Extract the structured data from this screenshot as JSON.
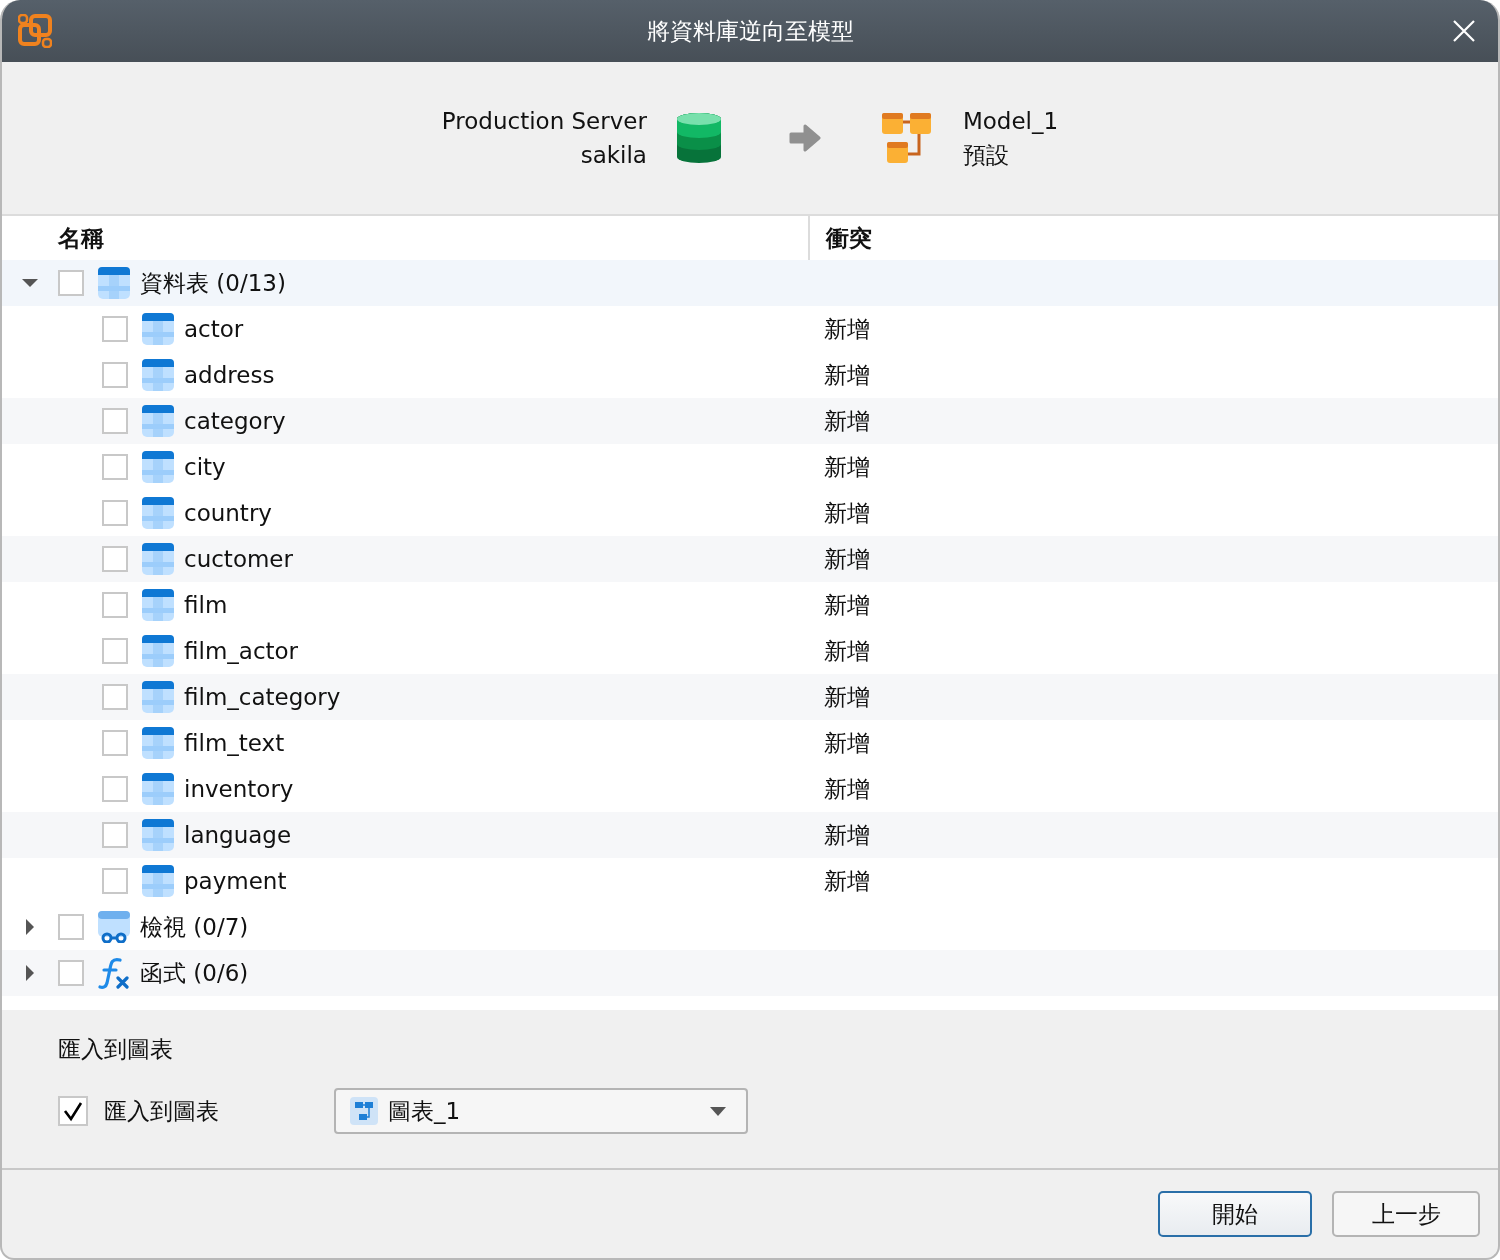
{
  "window": {
    "title": "將資料庫逆向至模型"
  },
  "source": {
    "connection": "Production Server",
    "database": "sakila"
  },
  "target": {
    "model": "Model_1",
    "schema": "預設"
  },
  "tree": {
    "columns": [
      "名稱",
      "衝突"
    ],
    "groups": [
      {
        "kind": "tables",
        "label": "資料表 (0/13)",
        "expanded": true,
        "checked": false,
        "children": [
          {
            "name": "actor",
            "checked": false,
            "conflict": "新增"
          },
          {
            "name": "address",
            "checked": false,
            "conflict": "新增"
          },
          {
            "name": "category",
            "checked": false,
            "conflict": "新增"
          },
          {
            "name": "city",
            "checked": false,
            "conflict": "新增"
          },
          {
            "name": "country",
            "checked": false,
            "conflict": "新增"
          },
          {
            "name": "cuctomer",
            "checked": false,
            "conflict": "新增"
          },
          {
            "name": "film",
            "checked": false,
            "conflict": "新增"
          },
          {
            "name": "film_actor",
            "checked": false,
            "conflict": "新增"
          },
          {
            "name": "film_category",
            "checked": false,
            "conflict": "新增"
          },
          {
            "name": "film_text",
            "checked": false,
            "conflict": "新增"
          },
          {
            "name": "inventory",
            "checked": false,
            "conflict": "新增"
          },
          {
            "name": "language",
            "checked": false,
            "conflict": "新增"
          },
          {
            "name": "payment",
            "checked": false,
            "conflict": "新增"
          }
        ]
      },
      {
        "kind": "views",
        "label": "檢視 (0/7)",
        "expanded": false,
        "checked": false
      },
      {
        "kind": "functions",
        "label": "函式 (0/6)",
        "expanded": false,
        "checked": false
      }
    ]
  },
  "import": {
    "heading": "匯入到圖表",
    "checkbox_label": "匯入到圖表",
    "checked": true,
    "diagram": "圖表_1"
  },
  "buttons": [
    {
      "label": "開始",
      "default": true
    },
    {
      "label": "上一步",
      "default": false
    }
  ]
}
